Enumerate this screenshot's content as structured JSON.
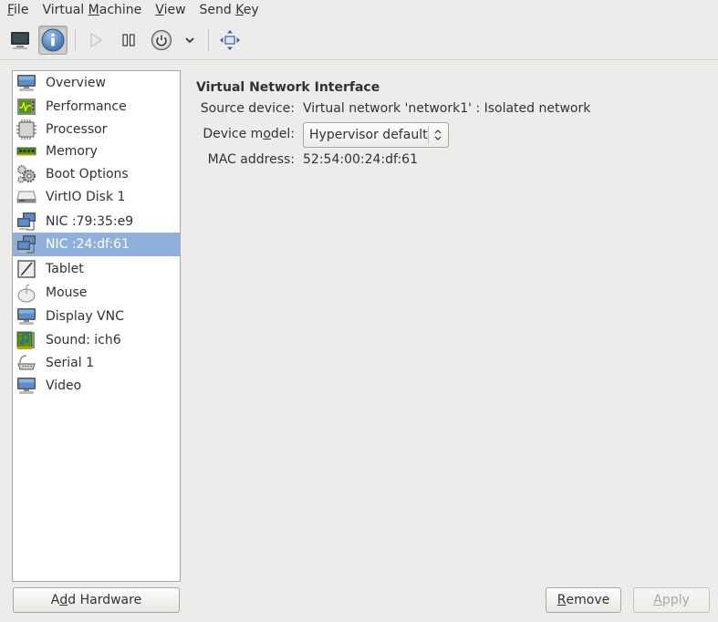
{
  "menubar": {
    "items": [
      {
        "label": "File",
        "mnemonic_index": 0
      },
      {
        "label": "Virtual Machine",
        "mnemonic_index": 8
      },
      {
        "label": "View",
        "mnemonic_index": 0
      },
      {
        "label": "Send Key",
        "mnemonic_index": 5
      }
    ]
  },
  "toolbar": {
    "buttons": [
      {
        "name": "show-console",
        "icon": "monitor-icon",
        "pressed": false,
        "enabled": true
      },
      {
        "name": "show-details",
        "icon": "info-icon",
        "pressed": true,
        "enabled": true
      },
      {
        "name": "run",
        "icon": "play-icon",
        "pressed": false,
        "enabled": false
      },
      {
        "name": "pause",
        "icon": "pause-icon",
        "pressed": false,
        "enabled": true
      },
      {
        "name": "shutdown",
        "icon": "power-icon",
        "pressed": false,
        "enabled": true
      },
      {
        "name": "shutdown-menu",
        "icon": "chevron-down-icon",
        "pressed": false,
        "enabled": true
      },
      {
        "name": "fullscreen",
        "icon": "fullscreen-icon",
        "pressed": false,
        "enabled": true
      }
    ]
  },
  "sidebar": {
    "items": [
      {
        "label": "Overview",
        "icon": "monitor-icon"
      },
      {
        "label": "Performance",
        "icon": "performance-icon"
      },
      {
        "label": "Processor",
        "icon": "cpu-icon"
      },
      {
        "label": "Memory",
        "icon": "memory-icon"
      },
      {
        "label": "Boot Options",
        "icon": "gears-icon"
      },
      {
        "label": "VirtIO Disk 1",
        "icon": "disk-icon"
      },
      {
        "label": "NIC :79:35:e9",
        "icon": "network-icon"
      },
      {
        "label": "NIC :24:df:61",
        "icon": "network-icon",
        "selected": true
      },
      {
        "label": "Tablet",
        "icon": "tablet-icon"
      },
      {
        "label": "Mouse",
        "icon": "mouse-icon"
      },
      {
        "label": "Display VNC",
        "icon": "monitor-icon"
      },
      {
        "label": "Sound: ich6",
        "icon": "sound-card-icon"
      },
      {
        "label": "Serial 1",
        "icon": "serial-icon"
      },
      {
        "label": "Video",
        "icon": "monitor-icon"
      }
    ],
    "selected_index": 7
  },
  "details": {
    "title": "Virtual Network Interface",
    "source_device_label": "Source device:",
    "source_device_value": "Virtual network 'network1' : Isolated network",
    "device_model_label_pre": "Device m",
    "device_model_label_mn": "o",
    "device_model_label_post": "del:",
    "device_model_value": "Hypervisor default",
    "mac_label": "MAC address:",
    "mac_value": "52:54:00:24:df:61"
  },
  "buttons": {
    "add_hardware_pre": "A",
    "add_hardware_mn": "d",
    "add_hardware_post": "d Hardware",
    "remove_mn": "R",
    "remove_post": "emove",
    "apply_mn": "A",
    "apply_post": "pply",
    "apply_enabled": false
  }
}
